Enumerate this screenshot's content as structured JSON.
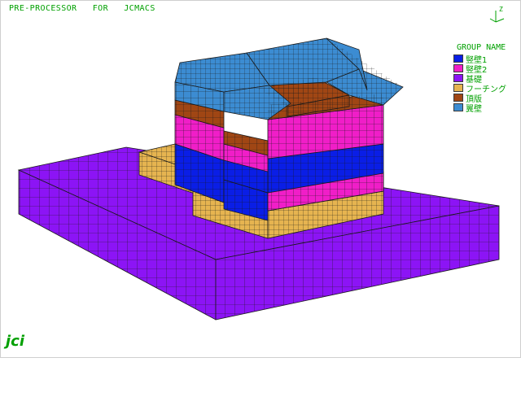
{
  "window": {
    "title": "PRE-PROCESSOR   FOR   JCMACS"
  },
  "axis": {
    "label": "Z"
  },
  "legend": {
    "title": "GROUP NAME",
    "items": [
      {
        "label": "竪壁1",
        "color": "#0a1ee6"
      },
      {
        "label": "竪壁2",
        "color": "#f01ec8"
      },
      {
        "label": "基礎",
        "color": "#8c14f5"
      },
      {
        "label": "フーチング",
        "color": "#e6b450"
      },
      {
        "label": "頂版",
        "color": "#a04614"
      },
      {
        "label": "翼壁",
        "color": "#3c8cd2"
      }
    ]
  },
  "logo": "jci",
  "colors": {
    "background": "#ffffff",
    "label": "#00a000",
    "mesh": "#1a1a1a"
  }
}
